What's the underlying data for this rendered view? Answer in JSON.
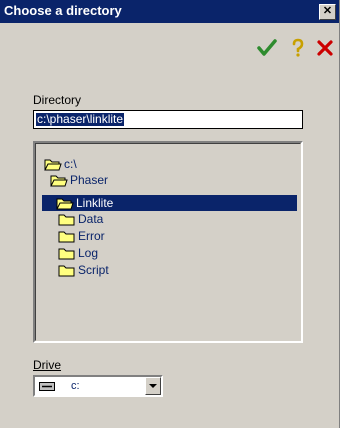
{
  "window": {
    "title": "Choose a directory",
    "close_glyph": "✕"
  },
  "toolbar": {
    "ok_icon": "checkmark-icon",
    "help_icon": "question-mark-icon",
    "cancel_icon": "x-icon"
  },
  "directory": {
    "label": "Directory",
    "value": "c:\\phaser\\linklite"
  },
  "tree": {
    "items": [
      {
        "label": "c:\\",
        "icon": "folder-open-icon",
        "level": 0,
        "selected": false
      },
      {
        "label": "Phaser",
        "icon": "folder-open-icon",
        "level": 1,
        "selected": false
      },
      {
        "label": "Linklite",
        "icon": "folder-open-icon",
        "level": 2,
        "selected": true
      },
      {
        "label": "Data",
        "icon": "folder-icon",
        "level": 3,
        "selected": false
      },
      {
        "label": "Error",
        "icon": "folder-icon",
        "level": 3,
        "selected": false
      },
      {
        "label": "Log",
        "icon": "folder-icon",
        "level": 3,
        "selected": false
      },
      {
        "label": "Script",
        "icon": "folder-icon",
        "level": 3,
        "selected": false
      }
    ]
  },
  "drive": {
    "label": "Drive",
    "value": "c:",
    "icon": "hard-drive-icon"
  },
  "colors": {
    "titlebar": "#0a246a",
    "selection": "#0a246a",
    "face": "#d4d0c8",
    "ok": "#2e8b2e",
    "cancel": "#cc0000",
    "help": "#c8a000"
  }
}
